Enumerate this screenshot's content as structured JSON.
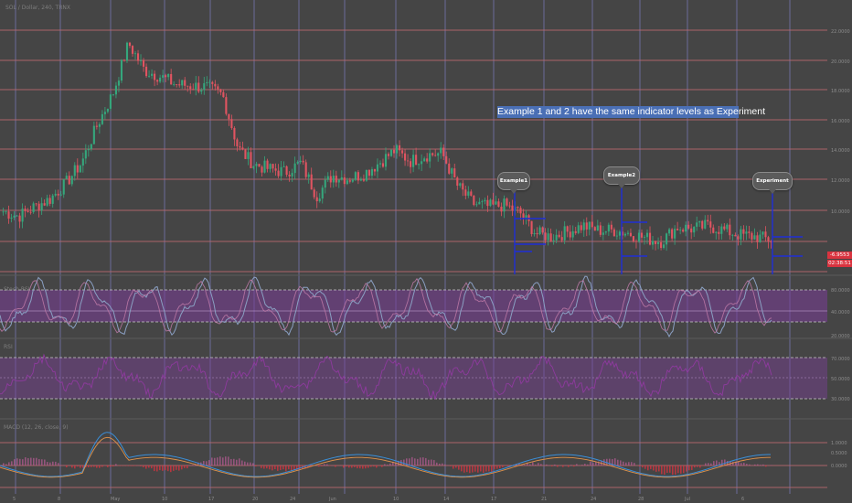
{
  "header": {
    "symbol_text": "SOL / Dollar, 240, TRNX"
  },
  "annotation": {
    "text": "Example 1 and 2 have the same indicator levels as Experiment"
  },
  "callouts": {
    "example1": "Example1",
    "example2": "Example2",
    "experiment": "Experiment"
  },
  "price_scale": {
    "last_price": "-6.9553",
    "countdown": "02:38:51",
    "ticks": [
      "22.0000",
      "20.0000",
      "18.0000",
      "16.0000",
      "14.0000",
      "12.0000",
      "10.0000"
    ]
  },
  "indicators": {
    "stoch_rsi_label": "Stoch RSI",
    "rsi_label": "RSI",
    "macd_label": "MACD (12, 26, close, 9)",
    "stoch_ticks": [
      "80.0000",
      "40.0000",
      "20.0000"
    ],
    "rsi_ticks": [
      "70.0000",
      "50.0000",
      "30.0000"
    ],
    "macd_ticks": [
      "1.0000",
      "0.5000",
      "0.0000"
    ]
  },
  "time_axis": {
    "ticks": [
      "5",
      "8",
      "May",
      "10",
      "17",
      "20",
      "24",
      "Jun",
      "10",
      "14",
      "17",
      "21",
      "24",
      "28",
      "Jul",
      "6"
    ]
  },
  "colors": {
    "background": "#454545",
    "grid_horizontal": "#b8686e",
    "grid_vertical": "#7d7ec2",
    "candle_up": "#35a67c",
    "candle_down": "#e05461",
    "band_fill": "#7a3d97",
    "indicator_line": "#8a9fc2",
    "annotation_bg": "#4a6fb5",
    "drawing_line": "#1f2fd6"
  },
  "chart_data": {
    "type": "line",
    "series": [
      {
        "values": [
          10.5,
          10.2,
          10.8,
          11.3,
          12.3,
          13.6,
          16.0,
          18.0,
          21.2,
          19.5,
          19.1,
          18.6,
          18.5,
          18.4,
          17.9,
          14.5,
          13.5,
          13.2,
          13.0,
          13.6,
          11.5,
          12.8,
          12.6,
          12.9,
          13.6,
          14.4,
          13.7,
          14.1,
          14.2,
          12.1,
          11.0,
          10.8,
          10.9,
          10.4,
          9.1,
          8.9,
          9.2,
          9.6,
          9.3,
          9.3,
          9.1,
          8.8,
          8.6,
          9.5,
          9.4,
          9.6,
          9.3,
          9.0,
          8.9,
          8.7
        ]
      }
    ],
    "ylim": [
      6.5,
      22.5
    ]
  }
}
